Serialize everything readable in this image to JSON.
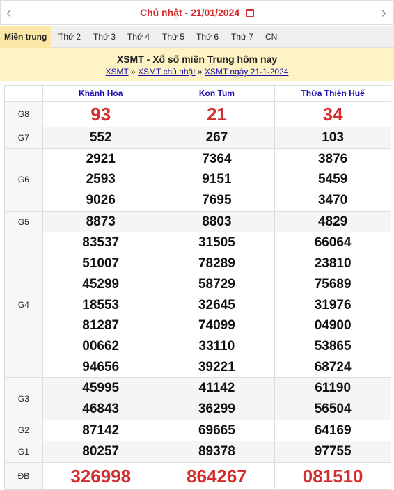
{
  "datebar": {
    "day": "Chủ nhật -",
    "date": "21/01/2024",
    "prev_icon": "‹",
    "next_icon": "›"
  },
  "tabs": [
    "Miền trung",
    "Thứ 2",
    "Thứ 3",
    "Thứ 4",
    "Thứ 5",
    "Thứ 6",
    "Thứ 7",
    "CN"
  ],
  "header": {
    "title": "XSMT - Xổ số miền Trung hôm nay",
    "crumb1": "XSMT",
    "crumb2": "XSMT chủ nhật",
    "crumb3": "XSMT ngày 21-1-2024",
    "sep": "»"
  },
  "provinces": [
    "Khánh Hòa",
    "Kon Tum",
    "Thừa Thiên Huế"
  ],
  "prizes": {
    "g8": {
      "label": "G8",
      "values": [
        [
          "93"
        ],
        [
          "21"
        ],
        [
          "34"
        ]
      ]
    },
    "g7": {
      "label": "G7",
      "values": [
        [
          "552"
        ],
        [
          "267"
        ],
        [
          "103"
        ]
      ]
    },
    "g6": {
      "label": "G6",
      "values": [
        [
          "2921",
          "2593",
          "9026"
        ],
        [
          "7364",
          "9151",
          "7695"
        ],
        [
          "3876",
          "5459",
          "3470"
        ]
      ]
    },
    "g5": {
      "label": "G5",
      "values": [
        [
          "8873"
        ],
        [
          "8803"
        ],
        [
          "4829"
        ]
      ]
    },
    "g4": {
      "label": "G4",
      "values": [
        [
          "83537",
          "51007",
          "45299",
          "18553",
          "81287",
          "00662",
          "94656"
        ],
        [
          "31505",
          "78289",
          "58729",
          "32645",
          "74099",
          "33110",
          "39221"
        ],
        [
          "66064",
          "23810",
          "75689",
          "31976",
          "04900",
          "53865",
          "68724"
        ]
      ]
    },
    "g3": {
      "label": "G3",
      "values": [
        [
          "45995",
          "46843"
        ],
        [
          "41142",
          "36299"
        ],
        [
          "61190",
          "56504"
        ]
      ]
    },
    "g2": {
      "label": "G2",
      "values": [
        [
          "87142"
        ],
        [
          "69665"
        ],
        [
          "64169"
        ]
      ]
    },
    "g1": {
      "label": "G1",
      "values": [
        [
          "80257"
        ],
        [
          "89378"
        ],
        [
          "97755"
        ]
      ]
    },
    "db": {
      "label": "ĐB",
      "values": [
        [
          "326998"
        ],
        [
          "864267"
        ],
        [
          "081510"
        ]
      ]
    }
  }
}
